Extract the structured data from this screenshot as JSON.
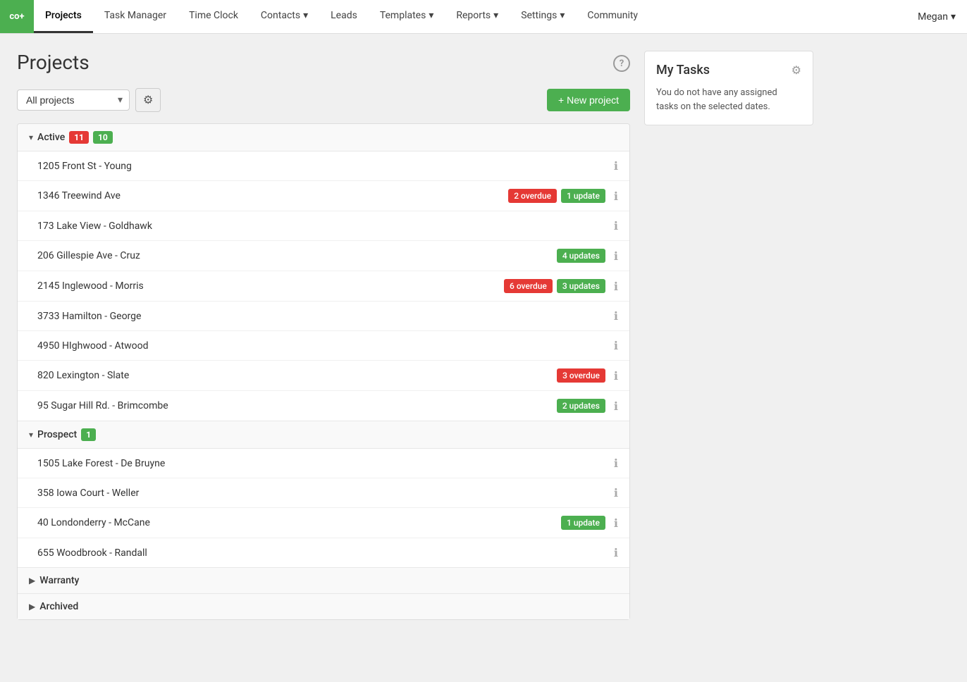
{
  "app": {
    "logo": "co+",
    "logo_bg": "#4caf50"
  },
  "nav": {
    "items": [
      {
        "label": "Projects",
        "active": true,
        "has_dropdown": false
      },
      {
        "label": "Task Manager",
        "active": false,
        "has_dropdown": false
      },
      {
        "label": "Time Clock",
        "active": false,
        "has_dropdown": false
      },
      {
        "label": "Contacts",
        "active": false,
        "has_dropdown": true
      },
      {
        "label": "Leads",
        "active": false,
        "has_dropdown": false
      },
      {
        "label": "Templates",
        "active": false,
        "has_dropdown": true
      },
      {
        "label": "Reports",
        "active": false,
        "has_dropdown": true
      },
      {
        "label": "Settings",
        "active": false,
        "has_dropdown": true
      },
      {
        "label": "Community",
        "active": false,
        "has_dropdown": false
      }
    ],
    "user": "Megan"
  },
  "page": {
    "title": "Projects",
    "new_project_btn": "+ New project",
    "filter_placeholder": "All projects"
  },
  "sections": [
    {
      "id": "active",
      "label": "Active",
      "expanded": true,
      "badge_red": "11",
      "badge_green": "10",
      "projects": [
        {
          "name": "1205 Front St - Young",
          "tags": []
        },
        {
          "name": "1346 Treewind Ave",
          "tags": [
            {
              "text": "2 overdue",
              "color": "red"
            },
            {
              "text": "1 update",
              "color": "green"
            }
          ]
        },
        {
          "name": "173 Lake View - Goldhawk",
          "tags": []
        },
        {
          "name": "206 Gillespie Ave - Cruz",
          "tags": [
            {
              "text": "4 updates",
              "color": "green"
            }
          ]
        },
        {
          "name": "2145 Inglewood - Morris",
          "tags": [
            {
              "text": "6 overdue",
              "color": "red"
            },
            {
              "text": "3 updates",
              "color": "green"
            }
          ]
        },
        {
          "name": "3733 Hamilton - George",
          "tags": []
        },
        {
          "name": "4950 Highwood - Atwood",
          "tags": []
        },
        {
          "name": "820 Lexington - Slate",
          "tags": [
            {
              "text": "3 overdue",
              "color": "red"
            }
          ]
        },
        {
          "name": "95 Sugar Hill Rd. - Brimcombe",
          "tags": [
            {
              "text": "2 updates",
              "color": "green"
            }
          ]
        }
      ]
    },
    {
      "id": "prospect",
      "label": "Prospect",
      "expanded": true,
      "badge_green": "1",
      "badge_red": null,
      "projects": [
        {
          "name": "1505 Lake Forest - De Bruyne",
          "tags": []
        },
        {
          "name": "358 Iowa Court - Weller",
          "tags": []
        },
        {
          "name": "40 Londonderry - McCane",
          "tags": [
            {
              "text": "1 update",
              "color": "green"
            }
          ]
        },
        {
          "name": "655 Woodbrook - Randall",
          "tags": []
        }
      ]
    },
    {
      "id": "warranty",
      "label": "Warranty",
      "expanded": false,
      "badge_red": null,
      "badge_green": null,
      "projects": []
    },
    {
      "id": "archived",
      "label": "Archived",
      "expanded": false,
      "badge_red": null,
      "badge_green": null,
      "projects": []
    }
  ],
  "my_tasks": {
    "title": "My Tasks",
    "empty_message": "You do not have any assigned tasks on the selected dates."
  }
}
